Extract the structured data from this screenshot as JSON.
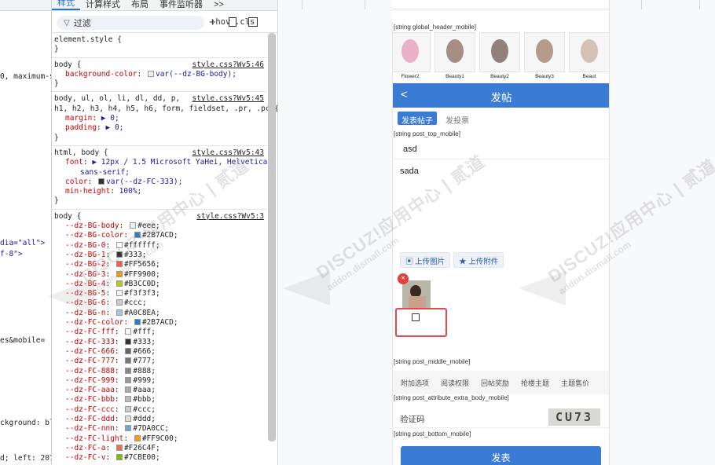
{
  "source_strip": {
    "lines": [
      "0, maximum-s",
      "dia=\"all\">",
      "f-8\">",
      "es&mobile=",
      "ckground: bl",
      "d; left: 207"
    ]
  },
  "devtools": {
    "tabs": [
      "样式",
      "计算样式",
      "布局",
      "事件监听器"
    ],
    "more_tabs": ">>",
    "filter_placeholder": "过滤",
    "hov": ":hov",
    "cls": ".cls",
    "plus": "+",
    "rules": [
      {
        "selector": "element.style {",
        "source": "",
        "lines": [],
        "close": "}"
      },
      {
        "selector": "body {",
        "source": "style.css?Wv5:46",
        "lines": [
          {
            "p": "background-color",
            "v": "var(--dz-BG-body);",
            "sw": "#eeeeee"
          }
        ],
        "close": "}"
      },
      {
        "selector": "body, ul, ol, li, dl, dd, p,",
        "selector2": "h1, h2, h3, h4, h5, h6, form, fieldset, .pr, .pc {",
        "source": "style.css?Wv5:45",
        "lines": [
          {
            "p": "margin",
            "v": "▶ 0;"
          },
          {
            "p": "padding",
            "v": "▶ 0;"
          }
        ],
        "close": "}"
      },
      {
        "selector": "html, body {",
        "source": "style.css?Wv5:43",
        "lines": [
          {
            "p": "font",
            "v": "▶ 12px / 1.5 Microsoft YaHei, Helvetica,"
          },
          {
            "p": "",
            "v": "sans-serif;"
          },
          {
            "p": "color",
            "v": "var(--dz-FC-333);",
            "sw": "#333333"
          },
          {
            "p": "min-height",
            "v": "100%;"
          }
        ],
        "close": "}"
      },
      {
        "selector": "body {",
        "source": "style.css?Wv5:3",
        "lines": [
          {
            "p": "--dz-BG-body",
            "v": "#eee;",
            "sw": "#eeeeee"
          },
          {
            "p": "--dz-BG-color",
            "v": "#2B7ACD;",
            "sw": "#2B7ACD"
          },
          {
            "p": "--dz-BG-0",
            "v": "#ffffff;",
            "sw": "#ffffff"
          },
          {
            "p": "--dz-BG-1",
            "v": "#333;",
            "sw": "#333333"
          },
          {
            "p": "--dz-BG-2",
            "v": "#FF5656;",
            "sw": "#FF5656"
          },
          {
            "p": "--dz-BG-3",
            "v": "#FF9900;",
            "sw": "#FF9900"
          },
          {
            "p": "--dz-BG-4",
            "v": "#B3CC0D;",
            "sw": "#B3CC0D"
          },
          {
            "p": "--dz-BG-5",
            "v": "#f3f3f3;",
            "sw": "#f3f3f3"
          },
          {
            "p": "--dz-BG-6",
            "v": "#ccc;",
            "sw": "#cccccc"
          },
          {
            "p": "--dz-BG-n",
            "v": "#A0C8EA;",
            "sw": "#A0C8EA"
          },
          {
            "p": "--dz-FC-color",
            "v": "#2B7ACD;",
            "sw": "#2B7ACD"
          },
          {
            "p": "--dz-FC-fff",
            "v": "#fff;",
            "sw": "#ffffff"
          },
          {
            "p": "--dz-FC-333",
            "v": "#333;",
            "sw": "#333333"
          },
          {
            "p": "--dz-FC-666",
            "v": "#666;",
            "sw": "#666666"
          },
          {
            "p": "--dz-FC-777",
            "v": "#777;",
            "sw": "#777777"
          },
          {
            "p": "--dz-FC-888",
            "v": "#888;",
            "sw": "#888888"
          },
          {
            "p": "--dz-FC-999",
            "v": "#999;",
            "sw": "#999999"
          },
          {
            "p": "--dz-FC-aaa",
            "v": "#aaa;",
            "sw": "#aaaaaa"
          },
          {
            "p": "--dz-FC-bbb",
            "v": "#bbb;",
            "sw": "#bbbbbb"
          },
          {
            "p": "--dz-FC-ccc",
            "v": "#ccc;",
            "sw": "#cccccc"
          },
          {
            "p": "--dz-FC-ddd",
            "v": "#ddd;",
            "sw": "#dddddd"
          },
          {
            "p": "--dz-FC-nnn",
            "v": "#7DA0CC;",
            "sw": "#7DA0CC"
          },
          {
            "p": "--dz-FC-light",
            "v": "#FF9C00;",
            "sw": "#FF9C00"
          },
          {
            "p": "--dz-FC-a",
            "v": "#F26C4F;",
            "sw": "#F26C4F"
          },
          {
            "p": "--dz-FC-v",
            "v": "#7CBE00;",
            "sw": "#7CBE00"
          }
        ],
        "close": ""
      }
    ]
  },
  "phone": {
    "header_tag": "[string global_header_mobile]",
    "thumbs": [
      {
        "caption": "Flower2",
        "color": "#e79ab6"
      },
      {
        "caption": "Beauty1",
        "color": "#8b6b5e"
      },
      {
        "caption": "Beauty2",
        "color": "#6e5a52"
      },
      {
        "caption": "Beauty3",
        "color": "#a07c66"
      },
      {
        "caption": "Beaut",
        "color": "#c8b0a0"
      }
    ],
    "nav_back": "<",
    "nav_title": "发帖",
    "segments": [
      "发表帖子",
      "发投票"
    ],
    "post_top_tag": "[string post_top_mobile]",
    "subject": "asd",
    "body": "sada",
    "upload_image": "上传图片",
    "upload_file": "上传附件",
    "delete_mark": "×",
    "post_middle_tag": "[string post_middle_mobile]",
    "attr_tabs": [
      "附加选项",
      "阅读权限",
      "回帖奖励",
      "抢楼主题",
      "主题售价"
    ],
    "attr_extra_tag": "[string post_attribute_extra_body_mobile]",
    "captcha_label": "验证码",
    "captcha_text": "CU73",
    "post_bottom_tag": "[string post_bottom_mobile]",
    "submit": "发表"
  },
  "watermark": {
    "line1": "DISCUZ!应用中心 | 贰道",
    "line2": "addon.dismall.com"
  }
}
